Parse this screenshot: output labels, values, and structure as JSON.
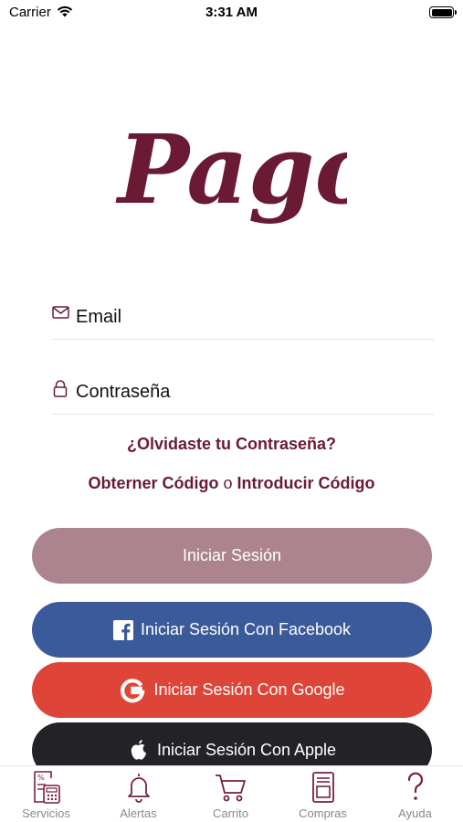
{
  "status_bar": {
    "carrier": "Carrier",
    "time": "3:31 AM",
    "wifi_icon": "wifi-icon",
    "battery_icon": "battery-icon"
  },
  "logo": {
    "text": "Pagos",
    "color": "#6b1a34"
  },
  "login_form": {
    "email": {
      "placeholder": "Email",
      "value": "",
      "icon": "envelope-icon"
    },
    "password": {
      "placeholder": "Contraseña",
      "value": "",
      "icon": "lock-icon"
    },
    "forgot_password": "¿Olvidaste tu Contraseña?",
    "get_code": "Obterner Código",
    "or_text": "o",
    "enter_code": "Introducir Código"
  },
  "buttons": {
    "login": {
      "label": "Iniciar Sesión",
      "color": "#ab848e"
    },
    "facebook": {
      "label": "Iniciar Sesión Con Facebook",
      "color": "#3b5a9a",
      "icon": "facebook-icon"
    },
    "google": {
      "label": "Iniciar Sesión Con Google",
      "color": "#de4437",
      "icon": "google-icon"
    },
    "apple": {
      "label": "Iniciar Sesión Con Apple",
      "color": "#232327",
      "icon": "apple-icon"
    }
  },
  "tab_bar": {
    "accent": "#7a1f3d",
    "label_color": "#8a8a8a",
    "items": [
      {
        "label": "Servicios",
        "icon": "services-icon"
      },
      {
        "label": "Alertas",
        "icon": "bell-icon"
      },
      {
        "label": "Carrito",
        "icon": "cart-icon"
      },
      {
        "label": "Compras",
        "icon": "purchases-icon"
      },
      {
        "label": "Ayuda",
        "icon": "help-icon"
      }
    ]
  }
}
